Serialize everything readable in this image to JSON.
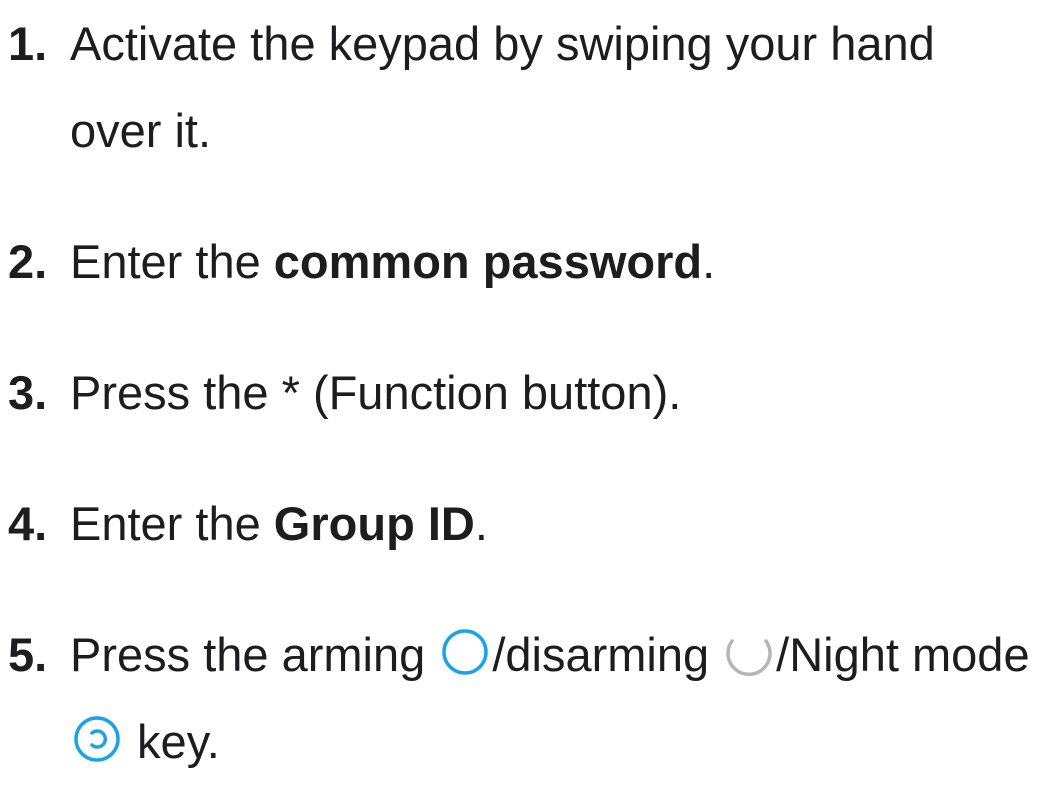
{
  "steps": [
    {
      "number": "1.",
      "text": "Activate the keypad by swiping your hand over it."
    },
    {
      "number": "2.",
      "prefix": "Enter the ",
      "bold": "common password",
      "suffix": "."
    },
    {
      "number": "3.",
      "text": "Press the * (Function button)."
    },
    {
      "number": "4.",
      "prefix": "Enter the ",
      "bold": "Group ID",
      "suffix": "."
    },
    {
      "number": "5.",
      "part1": "Press the arming ",
      "part2": "/disarming ",
      "part3": "/Night mode ",
      "part4": " key.",
      "icons": {
        "arming": "arming-circle-icon",
        "disarming": "disarming-circle-icon",
        "night": "night-mode-icon"
      }
    }
  ],
  "colors": {
    "text": "#1d1d1f",
    "icon_blue": "#1aa3e8",
    "icon_gray": "#b5b5b5"
  }
}
